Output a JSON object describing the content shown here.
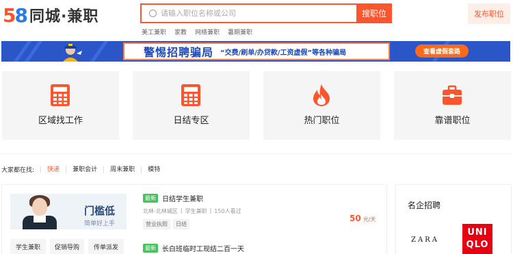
{
  "header": {
    "logo_num_5": "5",
    "logo_num_8": "8",
    "logo_brand": "同城·兼职",
    "search_placeholder": "请输入职位名称或公司",
    "search_button": "搜职位",
    "hot_words": [
      "美工兼职",
      "家教",
      "网络兼职",
      "暑期兼职"
    ],
    "publish_button": "发布职位"
  },
  "banner": {
    "headline": "警惕招聘骗局",
    "subline": "“交费/刷单/办贷款/工资虚假”等各种骗局",
    "cta": "查看虚假套路"
  },
  "categories": [
    {
      "label": "区域找工作",
      "icon": "calculator-icon"
    },
    {
      "label": "日结专区",
      "icon": "calculator-icon"
    },
    {
      "label": "热门职位",
      "icon": "flame-icon"
    },
    {
      "label": "靠谱职位",
      "icon": "briefcase-icon"
    }
  ],
  "popular": {
    "label": "大家都在找:",
    "links": [
      "快递",
      "兼职会计",
      "周末兼职",
      "模特"
    ]
  },
  "promo": {
    "title": "门槛低",
    "subtitle": "简单好上手"
  },
  "quick_tags": [
    "学生兼职",
    "促销导购",
    "传单派发"
  ],
  "jobs": [
    {
      "badge": "最新",
      "title": "日结学生兼职",
      "location": "北林-北林城区",
      "category": "学生兼职",
      "views": "150人看过",
      "chips": [
        "营业执照",
        "日结"
      ],
      "salary": "50",
      "unit": "元/天"
    },
    {
      "badge": "最新",
      "title": "长白班临时工现结二百一天"
    }
  ],
  "famous": {
    "heading": "名企招聘",
    "brands": [
      "ZARA",
      "UNI QLO"
    ]
  },
  "colors": {
    "accent": "#ff552e",
    "banner_blue": "#2b56c8",
    "badge_green": "#47c25d"
  }
}
